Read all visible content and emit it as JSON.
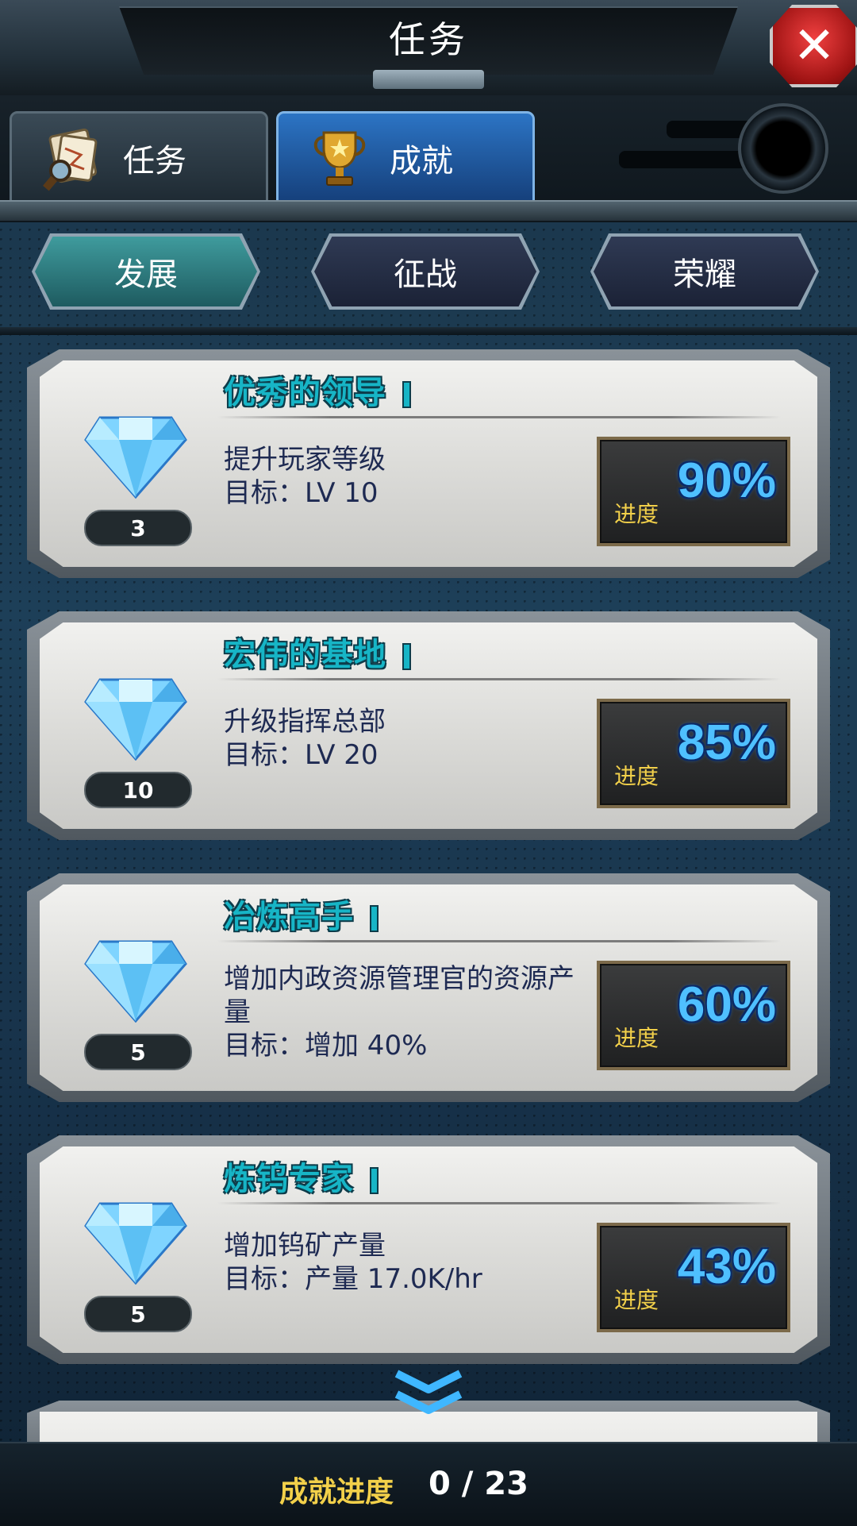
{
  "header": {
    "title": "任务",
    "close_icon": "close-icon"
  },
  "main_tabs": [
    {
      "label": "任务",
      "icon": "scroll-map-icon",
      "active": false
    },
    {
      "label": "成就",
      "icon": "trophy-icon",
      "active": true
    }
  ],
  "sub_tabs": [
    {
      "label": "发展",
      "active": true
    },
    {
      "label": "征战",
      "active": false
    },
    {
      "label": "荣耀",
      "active": false
    }
  ],
  "achievements": [
    {
      "title": "优秀的领导",
      "desc": "提升玩家等级",
      "goal": "目标：LV 10",
      "reward": "3",
      "progress_label": "进度",
      "progress": "90%"
    },
    {
      "title": "宏伟的基地",
      "desc": "升级指挥总部",
      "goal": "目标：LV 20",
      "reward": "10",
      "progress_label": "进度",
      "progress": "85%"
    },
    {
      "title": "冶炼高手",
      "desc": "增加内政资源管理官的资源产量",
      "goal": "目标：增加 40%",
      "reward": "5",
      "progress_label": "进度",
      "progress": "60%"
    },
    {
      "title": "炼钨专家",
      "desc": "增加钨矿产量",
      "goal": "目标：产量 17.0K/hr",
      "reward": "5",
      "progress_label": "进度",
      "progress": "43%"
    }
  ],
  "footer": {
    "label": "成就进度",
    "value": "0 / 23"
  },
  "colors": {
    "title_cyan": "#17b5c6",
    "progress_blue": "#4fc0ff",
    "label_yellow": "#f2d04a"
  }
}
